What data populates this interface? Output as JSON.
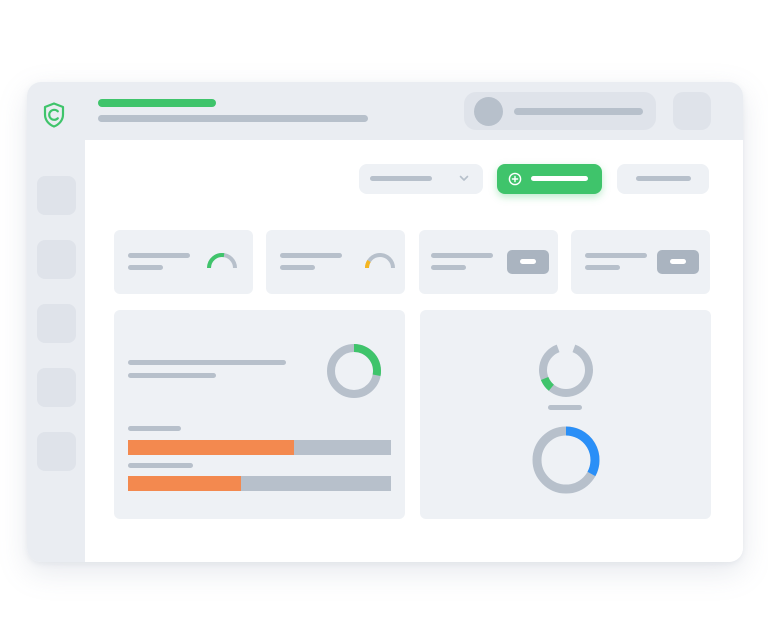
{
  "colors": {
    "accent": "#3fc46b",
    "warning": "#f5b621",
    "progress": "#f3894f",
    "info": "#2a8ff7",
    "skeleton": "#b7c0cb",
    "panel": "#eef1f5",
    "chrome": "#eaedf2"
  },
  "header": {
    "logo_icon": "shield-check-icon"
  },
  "sidebar": {
    "items": [
      {
        "icon": "placeholder"
      },
      {
        "icon": "placeholder"
      },
      {
        "icon": "placeholder"
      },
      {
        "icon": "placeholder"
      },
      {
        "icon": "placeholder"
      }
    ]
  },
  "toolbar": {
    "dropdown_icon": "chevron-down-icon",
    "primary_icon": "plus-circle-icon"
  },
  "stat_cards": [
    {
      "widget": "gauge",
      "gauge_value": 0.55,
      "gauge_color": "#3fc46b"
    },
    {
      "widget": "gauge",
      "gauge_value": 0.18,
      "gauge_color": "#f5b621"
    },
    {
      "widget": "chip"
    },
    {
      "widget": "chip"
    }
  ],
  "left_panel": {
    "donut_value": 0.28,
    "donut_color": "#3fc46b",
    "bars": [
      {
        "value": 0.63
      },
      {
        "value": 0.43
      }
    ]
  },
  "right_panel": {
    "ring_value": 0.08,
    "ring_color": "#3fc46b",
    "donut_value": 0.33,
    "donut_color": "#2a8ff7"
  }
}
